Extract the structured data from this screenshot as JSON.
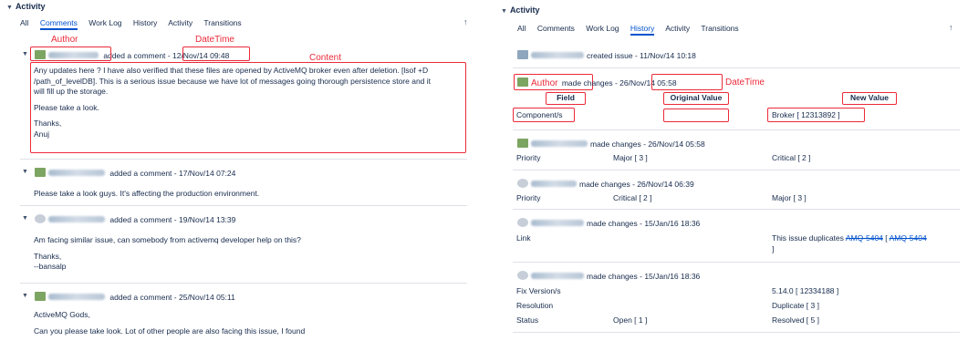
{
  "left": {
    "header": "Activity",
    "tabs": [
      "All",
      "Comments",
      "Work Log",
      "History",
      "Activity",
      "Transitions"
    ],
    "active_tab": "Comments",
    "annotations": {
      "author": "Author",
      "datetime": "DateTime",
      "content": "Content"
    },
    "comments": [
      {
        "action": "added a comment -",
        "date": "12/Nov/14 09:48",
        "lines": [
          "Any updates here ? I have also verified that these files are opened by ActiveMQ broker even after deletion. [lsof +D",
          "/path_of_levelDB]. This is a serious issue because we have lot of messages going thorough persistence store and it",
          "will fill up the storage.",
          "",
          "Please take a look.",
          "",
          "Thanks,",
          "Anuj"
        ]
      },
      {
        "action": "added a comment -",
        "date": "17/Nov/14 07:24",
        "lines": [
          "Please take a look guys. It's affecting the production environment."
        ]
      },
      {
        "action": "added a comment -",
        "date": "19/Nov/14 13:39",
        "lines": [
          "Am facing similar issue, can somebody from activemq developer help on this?",
          "",
          "Thanks,",
          "--bansalp"
        ]
      },
      {
        "action": "added a comment -",
        "date": "25/Nov/14 05:11",
        "lines": [
          "ActiveMQ Gods,",
          "",
          "Can you please take look. Lot of other people are also facing this issue, I found"
        ]
      }
    ]
  },
  "right": {
    "header": "Activity",
    "tabs": [
      "All",
      "Comments",
      "Work Log",
      "History",
      "Activity",
      "Transitions"
    ],
    "active_tab": "History",
    "annotations": {
      "author": "Author",
      "datetime": "DateTime",
      "field": "Field",
      "original": "Original Value",
      "new": "New Value"
    },
    "entries": [
      {
        "text": "created issue - 11/Nov/14 10:18"
      },
      {
        "text": "made changes -",
        "date": "26/Nov/14 05:58",
        "field": "Component/s",
        "original": "",
        "new": "Broker [ 12313892 ]"
      },
      {
        "text": "made changes - 26/Nov/14 05:58",
        "field": "Priority",
        "original": "Major [ 3 ]",
        "new": "Critical [ 2 ]"
      },
      {
        "text": "made changes - 26/Nov/14 06:39",
        "field": "Priority",
        "original": "Critical [ 2 ]",
        "new": "Major [ 3 ]"
      },
      {
        "text": "made changes - 15/Jan/16 18:36",
        "field": "Link",
        "new_prefix": "This issue duplicates",
        "new_link1": "AMQ-5404",
        "new_sep": "[",
        "new_link2": "AMQ-5404",
        "new_suffix": "]"
      },
      {
        "text": "made changes - 15/Jan/16 18:36",
        "rows": [
          {
            "field": "Fix Version/s",
            "original": "",
            "new": "5.14.0 [ 12334188 ]"
          },
          {
            "field": "Resolution",
            "original": "",
            "new": "Duplicate [ 3 ]"
          },
          {
            "field": "Status",
            "original": "Open [ 1 ]",
            "new": "Resolved [ 5 ]"
          }
        ]
      }
    ]
  }
}
